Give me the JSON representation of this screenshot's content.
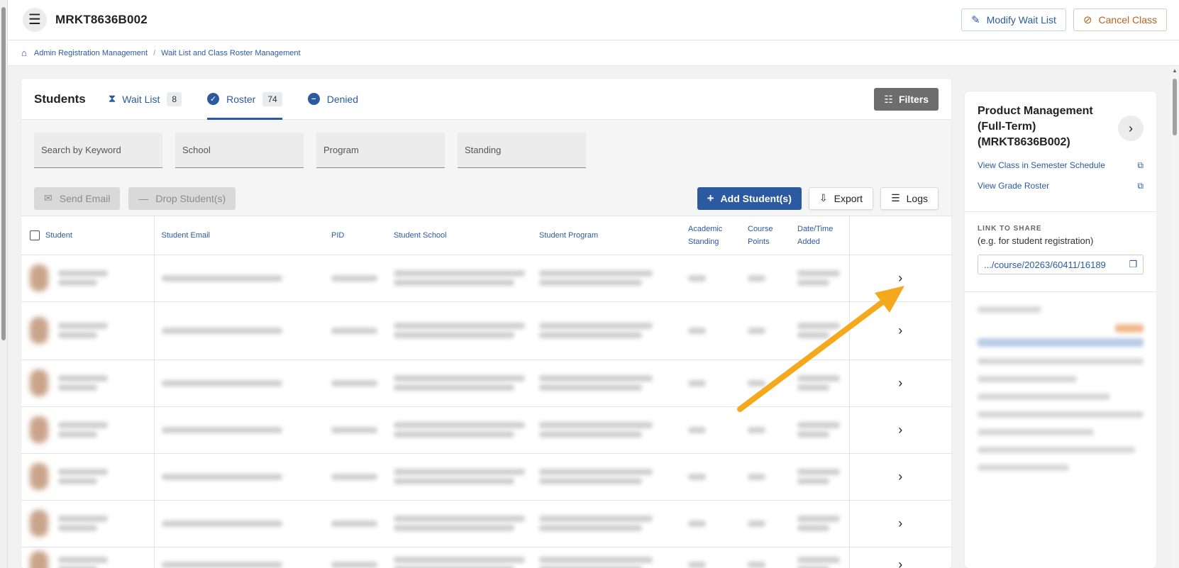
{
  "header": {
    "title": "MRKT8636B002",
    "modify_label": "Modify Wait List",
    "cancel_label": "Cancel Class"
  },
  "breadcrumb": {
    "items": [
      "Admin Registration Management",
      "Wait List and Class Roster Management"
    ]
  },
  "students": {
    "title": "Students",
    "tabs": [
      {
        "label": "Wait List",
        "count": "8",
        "icon": "hourglass-icon"
      },
      {
        "label": "Roster",
        "count": "74",
        "icon": "check-circle-icon",
        "active": true
      },
      {
        "label": "Denied",
        "icon": "minus-circle-icon"
      }
    ],
    "filters_label": "Filters",
    "search": {
      "keyword": "Search by Keyword",
      "school": "School",
      "program": "Program",
      "standing": "Standing"
    },
    "actions": {
      "send_email": "Send Email",
      "drop_student": "Drop Student(s)",
      "add_students": "Add Student(s)",
      "export": "Export",
      "logs": "Logs"
    },
    "table": {
      "columns": {
        "student": "Student",
        "email": "Student Email",
        "pid": "PID",
        "school": "Student School",
        "program": "Student Program",
        "academic": "Academic",
        "standing": "Standing",
        "course": "Course",
        "points": "Points",
        "datetime": "Date/Time",
        "added": "Added"
      },
      "row_count": 7
    }
  },
  "panel": {
    "course_title": "Product Management (Full-Term) (MRKT8636B002)",
    "view_schedule": "View Class in Semester Schedule",
    "view_grade": "View Grade Roster",
    "share_label": "LINK TO SHARE",
    "share_sub": "(e.g. for student registration)",
    "share_link": ".../course/20263/60411/16189"
  },
  "colors": {
    "primary": "#2c5aa0",
    "danger": "#b8621b",
    "annotation_arrow": "#f4a81c"
  }
}
